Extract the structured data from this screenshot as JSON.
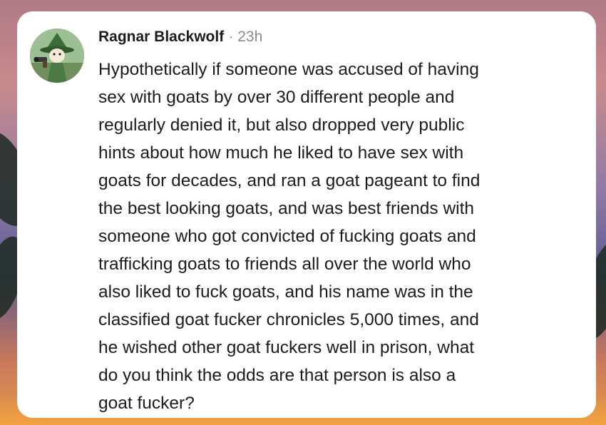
{
  "post": {
    "author": "Ragnar Blackwolf",
    "separator": "·",
    "time": "23h",
    "avatar_icon": "cartoon-wanderer-avatar-icon",
    "lines": [
      "Hypothetically if someone was accused of having",
      "sex with goats by over 30 different people and",
      "regularly denied it, but also dropped very public",
      "hints about how much he liked to have sex with",
      "goats for decades, and ran a goat pageant to find",
      "the best looking goats, and was best friends with",
      "someone who got convicted of fucking goats and",
      "trafficking goats to friends all over the world who",
      "also liked to fuck goats, and his name was in the",
      "classified goat fucker chronicles 5,000 times, and",
      "he wished other goat fuckers well in prison, what",
      "do you think the odds are that person is also a",
      "goat fucker?"
    ]
  },
  "colors": {
    "card_background": "#ffffff",
    "text": "#1c1c1c",
    "meta_text": "#8a8a8a"
  }
}
